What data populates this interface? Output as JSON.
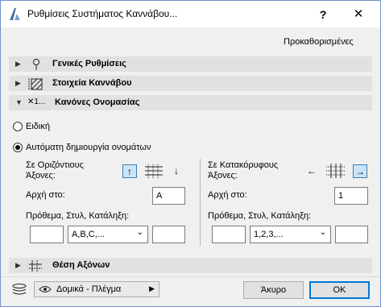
{
  "window": {
    "title": "Ρυθμίσεις Συστήματος Καννάβου...",
    "help_label": "?",
    "close_label": "✕"
  },
  "presets_label": "Προκαθορισμένες",
  "sections": {
    "general": "Γενικές Ρυθμίσεις",
    "grid_elements": "Στοιχεία Καννάβου",
    "naming_rules": "Κανόνες Ονομασίας",
    "naming_icon_text": "✕1...",
    "axes_position": "Θέση Αξόνων"
  },
  "naming": {
    "option_special": "Ειδική",
    "option_auto": "Αυτόματη δημιουργία ονομάτων",
    "selected": "auto"
  },
  "horizontal": {
    "label": "Σε Οριζόντιους Άξονες:",
    "label_line1": "Σε Οριζόντιους",
    "label_line2": "Άξονες:",
    "start_label": "Αρχή στο:",
    "start_value": "A",
    "psl_label": "Πρόθεμα, Στυλ, Κατάληξη:",
    "prefix": "",
    "style": "A,B,C,...",
    "suffix": "",
    "active_direction": "up"
  },
  "vertical": {
    "label": "Σε Κατακόρυφους Άξονες:",
    "label_line1": "Σε Κατακόρυφους",
    "label_line2": "Άξονες:",
    "start_label": "Αρχή στο:",
    "start_value": "1",
    "psl_label": "Πρόθεμα, Στυλ, Κατάληξη:",
    "prefix": "",
    "style": "1,2,3,...",
    "suffix": "",
    "active_direction": "right"
  },
  "footer": {
    "layer_label": "Δομικά - Πλέγμα",
    "cancel_label": "Άκυρο",
    "ok_label": "OK"
  },
  "colors": {
    "active_toggle": "#cce4f7",
    "window_border": "#6f93c8",
    "primary_border": "#0078d7"
  }
}
